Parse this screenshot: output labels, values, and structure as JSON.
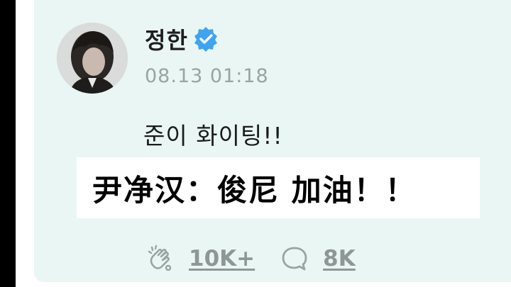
{
  "post": {
    "author": "정한",
    "timestamp": "08.13 01:18",
    "text": "준이 화이팅!!",
    "subtitle": "尹净汉：俊尼 加油！！",
    "likes": "10K+",
    "comments": "8K"
  },
  "icons": {
    "verified": "verified-badge-icon",
    "like": "cheer-clap-icon",
    "comment": "speech-bubble-icon",
    "avatar": "avatar-photo"
  },
  "colors": {
    "card_background": "#e9f6f3",
    "verified_blue": "#3fa4f0",
    "muted_text": "#9aa3a2"
  }
}
